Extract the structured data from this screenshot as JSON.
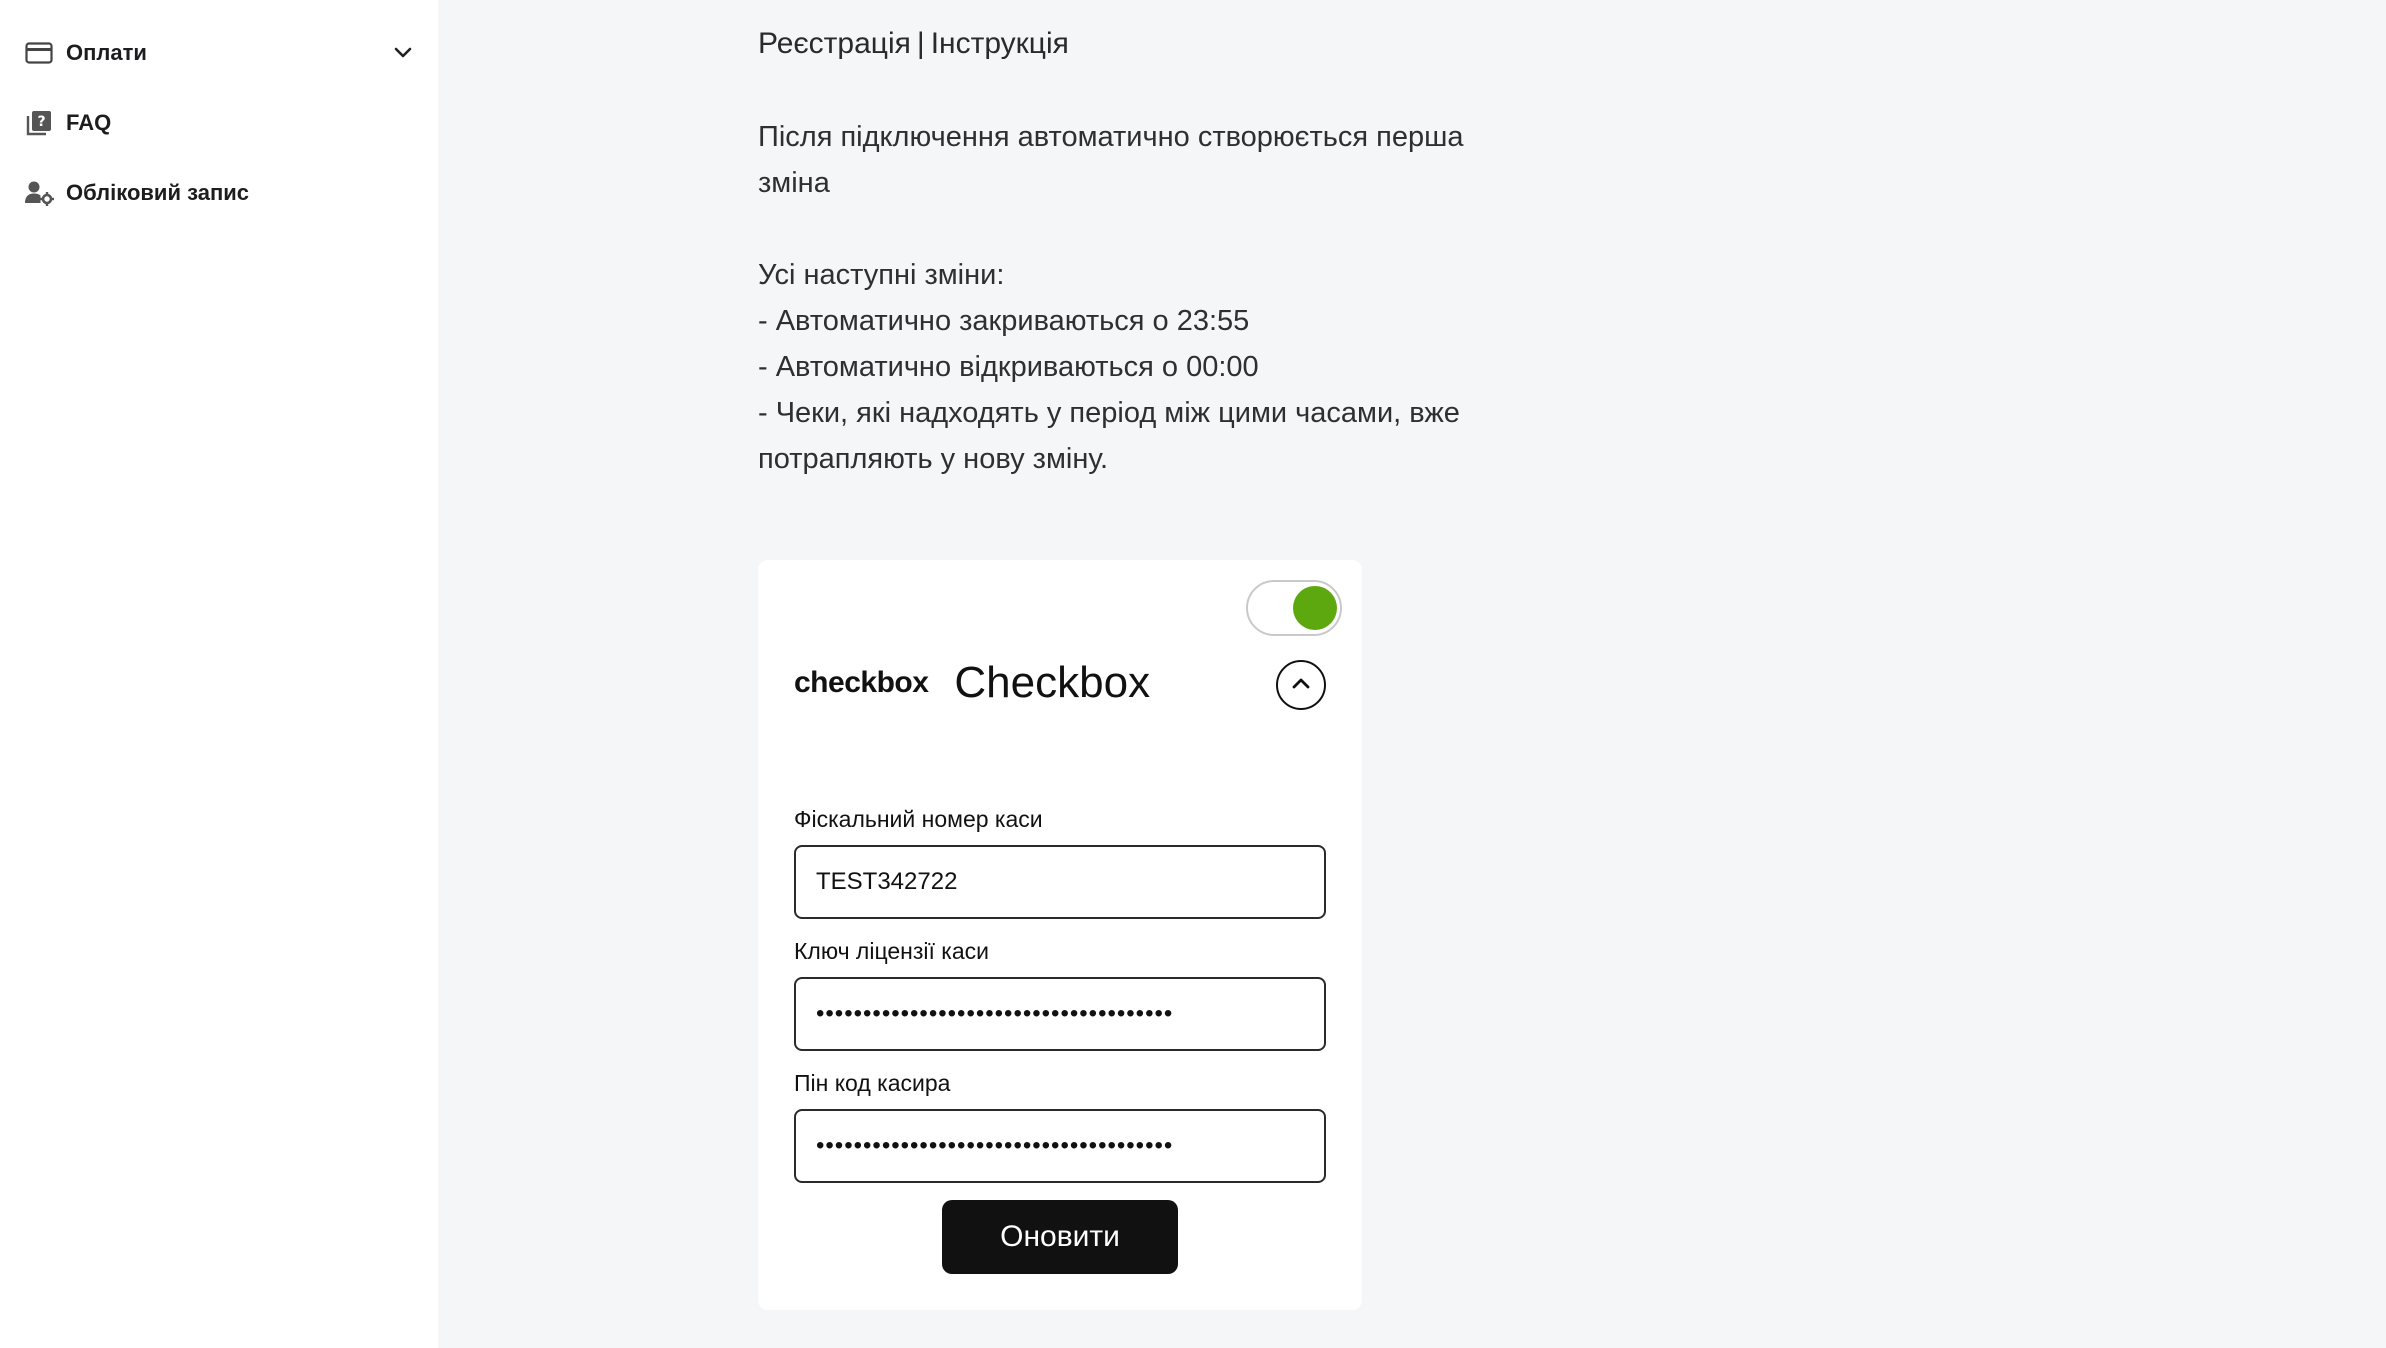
{
  "sidebar": {
    "items": [
      {
        "label": "Оплати",
        "icon": "credit-card-icon",
        "expandable": true
      },
      {
        "label": "FAQ",
        "icon": "help-book-icon"
      },
      {
        "label": "Обліковий запис",
        "icon": "user-settings-icon"
      }
    ]
  },
  "content": {
    "links": {
      "registration": "Реєстрація",
      "separator": "|",
      "instruction": "Інструкція"
    },
    "info": {
      "line1": "Після підключення автоматично створюється перша зміна",
      "line2": "Усі наступні зміни:",
      "line3": "- Автоматично закриваються о 23:55",
      "line4": "- Автоматично відкриваються о 00:00",
      "line5": "- Чеки, які надходять у період між цими часами, вже потрапляють у нову зміну."
    }
  },
  "card": {
    "enabled": true,
    "toggle_color": "#5da80f",
    "brand_logo": "checkbox",
    "brand_title": "Checkbox",
    "fields": {
      "fiscal_label": "Фіскальний номер каси",
      "fiscal_value": "TEST342722",
      "license_label": "Ключ ліцензії каси",
      "license_value": "••••••••••••••••••••••••••••••••••••••",
      "pin_label": "Пін код касира",
      "pin_value": "••••••••••••••••••••••••••••••••••••••"
    },
    "submit_label": "Оновити"
  }
}
